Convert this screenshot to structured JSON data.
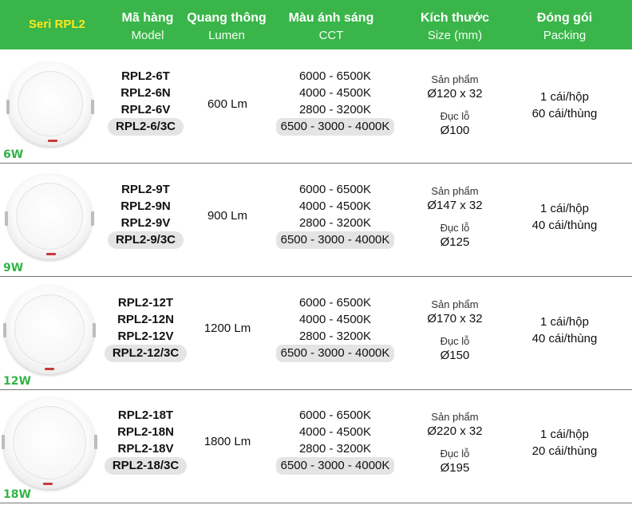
{
  "header": {
    "series": "Seri RPL2",
    "model_title": "Mã hàng",
    "model_sub": "Model",
    "lumen_title": "Quang thông",
    "lumen_sub": "Lumen",
    "cct_title": "Màu ánh sáng",
    "cct_sub": "CCT",
    "size_title": "Kích thước",
    "size_sub": "Size (mm)",
    "pack_title": "Đóng gói",
    "pack_sub": "Packing"
  },
  "rows": [
    {
      "watt": "6W",
      "models": [
        "RPL2-6T",
        "RPL2-6N",
        "RPL2-6V",
        "RPL2-6/3C"
      ],
      "lumen": "600 Lm",
      "cct": [
        "6000 - 6500K",
        "4000 - 4500K",
        "2800 - 3200K",
        "6500 - 3000 - 4000K"
      ],
      "size_label": "Sản phẩm",
      "size_value": "Ø120 x 32",
      "cut_label": "Đục lỗ",
      "cut_value": "Ø100",
      "pack": [
        "1 cái/hộp",
        "60 cái/thùng"
      ]
    },
    {
      "watt": "9W",
      "models": [
        "RPL2-9T",
        "RPL2-9N",
        "RPL2-9V",
        "RPL2-9/3C"
      ],
      "lumen": "900 Lm",
      "cct": [
        "6000 - 6500K",
        "4000 - 4500K",
        "2800 - 3200K",
        "6500 - 3000 - 4000K"
      ],
      "size_label": "Sản phẩm",
      "size_value": "Ø147 x 32",
      "cut_label": "Đục lỗ",
      "cut_value": "Ø125",
      "pack": [
        "1 cái/hộp",
        "40 cái/thùng"
      ]
    },
    {
      "watt": "12W",
      "models": [
        "RPL2-12T",
        "RPL2-12N",
        "RPL2-12V",
        "RPL2-12/3C"
      ],
      "lumen": "1200 Lm",
      "cct": [
        "6000 - 6500K",
        "4000 - 4500K",
        "2800 - 3200K",
        "6500 - 3000 - 4000K"
      ],
      "size_label": "Sản phẩm",
      "size_value": "Ø170 x 32",
      "cut_label": "Đục lỗ",
      "cut_value": "Ø150",
      "pack": [
        "1 cái/hộp",
        "40 cái/thùng"
      ]
    },
    {
      "watt": "18W",
      "models": [
        "RPL2-18T",
        "RPL2-18N",
        "RPL2-18V",
        "RPL2-18/3C"
      ],
      "lumen": "1800 Lm",
      "cct": [
        "6000 - 6500K",
        "4000 - 4500K",
        "2800 - 3200K",
        "6500 - 3000 - 4000K"
      ],
      "size_label": "Sản phẩm",
      "size_value": "Ø220 x 32",
      "cut_label": "Đục lỗ",
      "cut_value": "Ø195",
      "pack": [
        "1 cái/hộp",
        "20 cái/thùng"
      ]
    }
  ],
  "colors": {
    "header_bg": "#3ab54a",
    "series_text": "#ffe81a",
    "watt_text": "#34b34a",
    "pill_bg": "#e4e4e4"
  }
}
